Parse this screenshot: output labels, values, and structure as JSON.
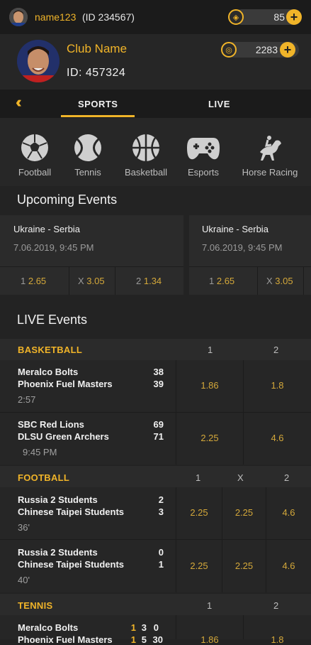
{
  "header": {
    "username": "name123",
    "user_id_text": "(ID 234567)",
    "coins": "85"
  },
  "profile": {
    "club_name": "Club Name",
    "club_id": "ID: 457324",
    "points": "2283"
  },
  "tabs": {
    "sports": "SPORTS",
    "live": "LIVE"
  },
  "sports": [
    {
      "label": "Football",
      "icon": "soccer-ball-icon"
    },
    {
      "label": "Tennis",
      "icon": "tennis-ball-icon"
    },
    {
      "label": "Basketball",
      "icon": "basketball-icon"
    },
    {
      "label": "Esports",
      "icon": "gamepad-icon"
    },
    {
      "label": "Horse Racing",
      "icon": "horse-racing-icon"
    }
  ],
  "upcoming": {
    "title": "Upcoming Events",
    "events": [
      {
        "teams": "Ukraine - Serbia",
        "date": "7.06.2019, 9:45 PM",
        "odds": [
          {
            "k": "1",
            "v": "2.65"
          },
          {
            "k": "X",
            "v": "3.05"
          },
          {
            "k": "2",
            "v": "1.34"
          }
        ]
      },
      {
        "teams": "Ukraine - Serbia",
        "date": "7.06.2019, 9:45 PM",
        "odds": [
          {
            "k": "1",
            "v": "2.65"
          },
          {
            "k": "X",
            "v": "3.05"
          }
        ]
      }
    ]
  },
  "live": {
    "title": "LIVE Events",
    "basketball": {
      "name": "BASKETBALL",
      "cols": [
        "1",
        "2"
      ],
      "matches": [
        {
          "team1": "Meralco Bolts",
          "team2": "Phoenix Fuel Masters",
          "score1": "38",
          "score2": "39",
          "time": "2:57",
          "odds": [
            "1.86",
            "1.8"
          ]
        },
        {
          "team1": "SBC Red Lions",
          "team2": "DLSU Green Archers",
          "score1": "69",
          "score2": "71",
          "time": "9:45 PM",
          "odds": [
            "2.25",
            "4.6"
          ]
        }
      ]
    },
    "football": {
      "name": "FOOTBALL",
      "cols": [
        "1",
        "X",
        "2"
      ],
      "matches": [
        {
          "team1": "Russia 2 Students",
          "team2": "Chinese Taipei Students",
          "score1": "2",
          "score2": "3",
          "time": "36'",
          "odds": [
            "2.25",
            "2.25",
            "4.6"
          ]
        },
        {
          "team1": "Russia 2 Students",
          "team2": "Chinese Taipei Students",
          "score1": "0",
          "score2": "1",
          "time": "40'",
          "odds": [
            "2.25",
            "2.25",
            "4.6"
          ]
        }
      ]
    },
    "tennis": {
      "name": "TENNIS",
      "cols": [
        "1",
        "2"
      ],
      "matches": [
        {
          "team1": "Meralco Bolts",
          "team2": "Phoenix Fuel Masters",
          "sets1": [
            "1",
            "3",
            "0"
          ],
          "sets2": [
            "1",
            "5",
            "30"
          ],
          "odds": [
            "1.86",
            "1.8"
          ]
        }
      ]
    }
  },
  "colors": {
    "accent": "#f0b429",
    "background": "#232323",
    "odds": "#d4a83a"
  }
}
